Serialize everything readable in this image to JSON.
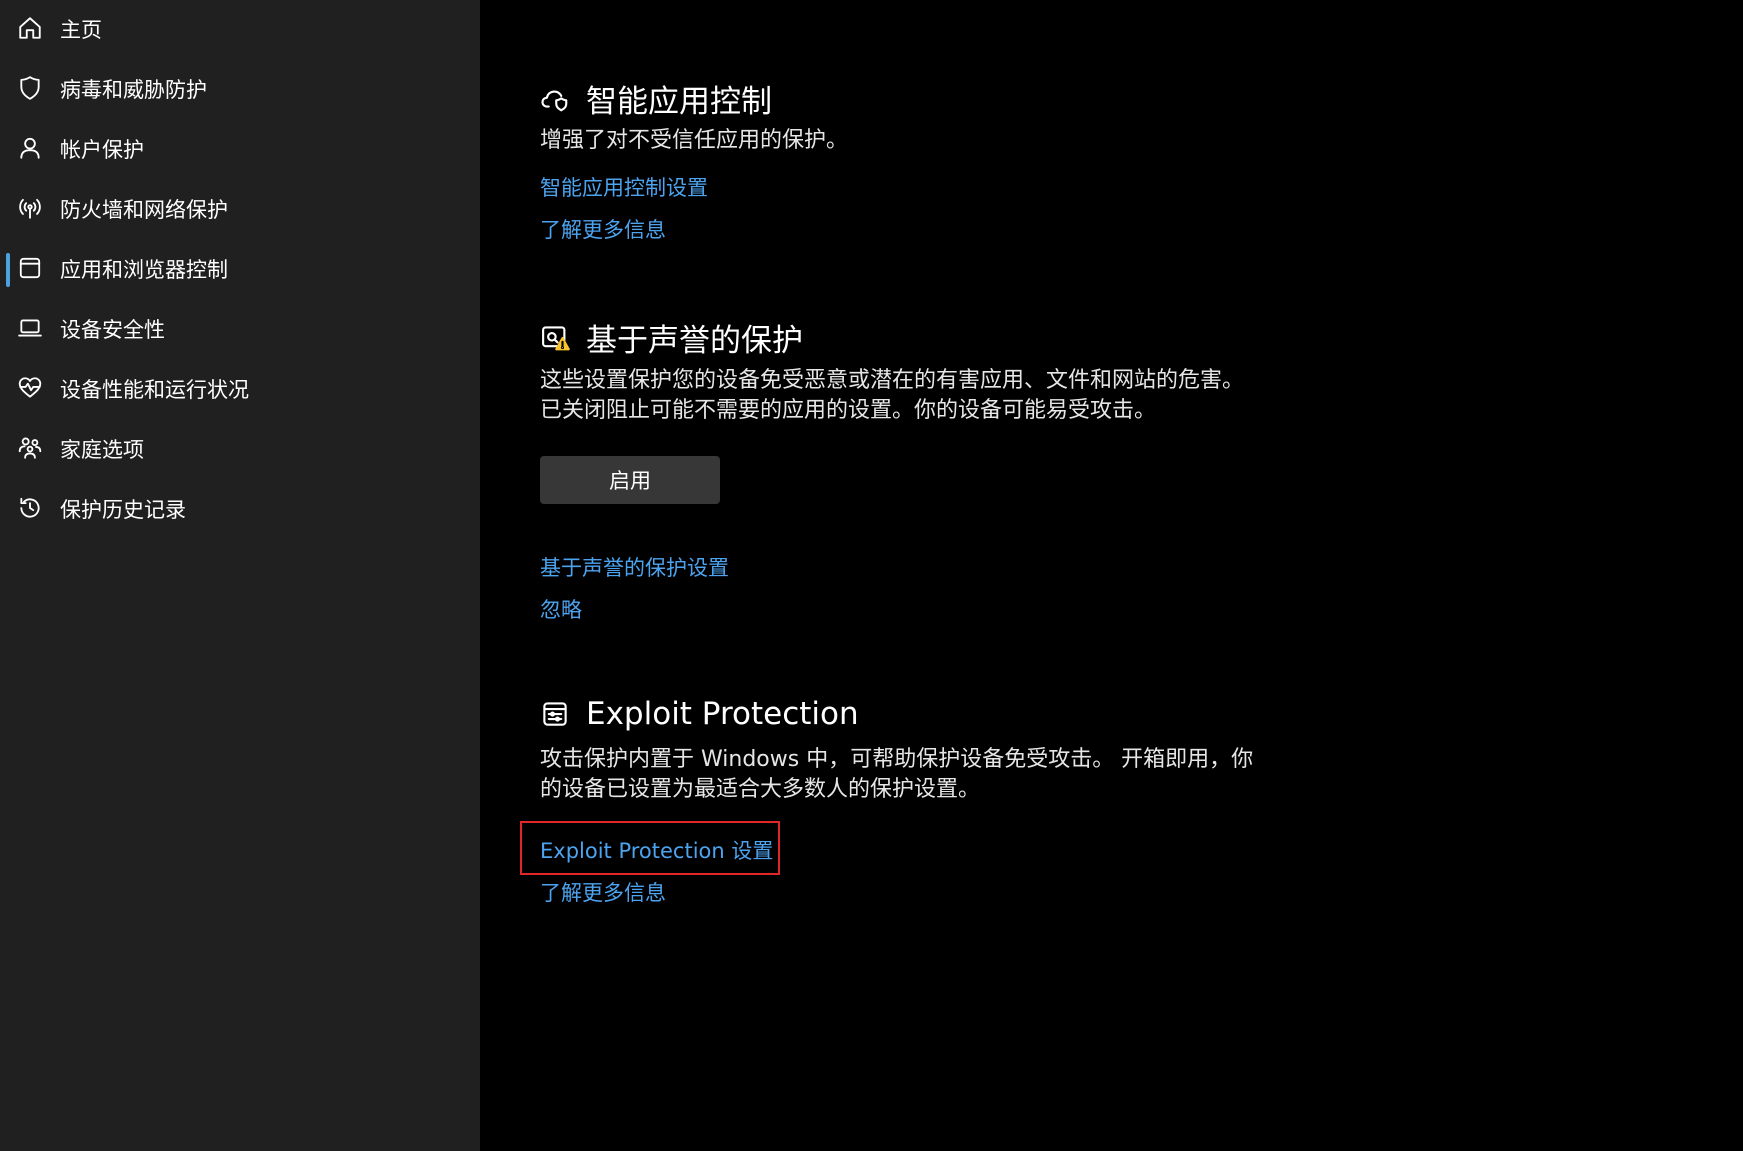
{
  "sidebar": {
    "items": [
      {
        "label": "主页",
        "icon": "home-icon"
      },
      {
        "label": "病毒和威胁防护",
        "icon": "shield-icon"
      },
      {
        "label": "帐户保护",
        "icon": "person-icon"
      },
      {
        "label": "防火墙和网络保护",
        "icon": "wifi-signal-icon"
      },
      {
        "label": "应用和浏览器控制",
        "icon": "app-window-icon",
        "active": true
      },
      {
        "label": "设备安全性",
        "icon": "laptop-icon"
      },
      {
        "label": "设备性能和运行状况",
        "icon": "heart-pulse-icon"
      },
      {
        "label": "家庭选项",
        "icon": "family-icon"
      },
      {
        "label": "保护历史记录",
        "icon": "history-icon"
      }
    ],
    "accent_color": "#4ca0e0"
  },
  "main": {
    "smart_app_control": {
      "title": "智能应用控制",
      "description": "增强了对不受信任应用的保护。",
      "settings_link": "智能应用控制设置",
      "learn_more_link": "了解更多信息",
      "icon": "cloud-shield-icon"
    },
    "reputation_protection": {
      "title": "基于声誉的保护",
      "description_line1": "这些设置保护您的设备免受恶意或潜在的有害应用、文件和网站的危害。",
      "description_line2": "已关闭阻止可能不需要的应用的设置。你的设备可能易受攻击。",
      "enable_button": "启用",
      "settings_link": "基于声誉的保护设置",
      "dismiss_link": "忽略",
      "icon": "reputation-warning-icon",
      "warning_color": "#f7c32e"
    },
    "exploit_protection": {
      "title": "Exploit Protection",
      "description_line1": "攻击保护内置于 Windows 中，可帮助保护设备免受攻击。 开箱即用，你",
      "description_line2": "的设备已设置为最适合大多数人的保护设置。",
      "settings_link": "Exploit Protection 设置",
      "learn_more_link": "了解更多信息",
      "icon": "exploit-settings-icon",
      "highlight_color": "#e0262a"
    },
    "link_color": "#4ca3ef"
  }
}
